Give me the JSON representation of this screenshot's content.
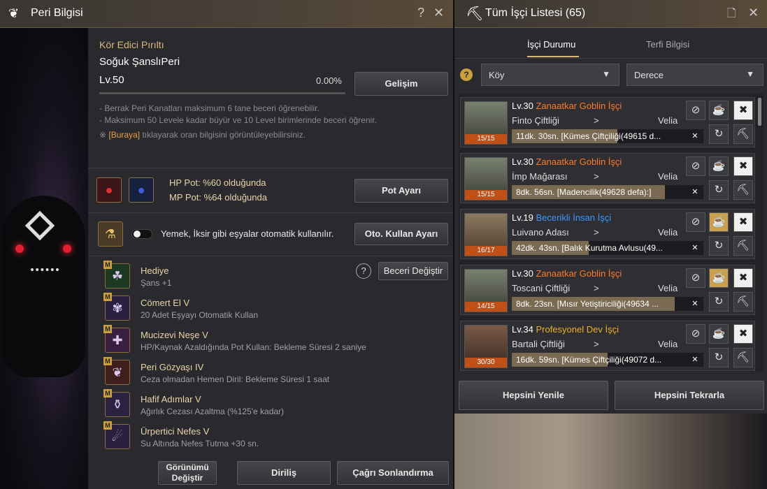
{
  "left": {
    "title": "Peri Bilgisi",
    "help": "?",
    "close": "✕",
    "fairy_title": "Kör Edici Pırıltı",
    "fairy_name": "Soğuk ŞanslıPeri",
    "level": "Lv.50",
    "percent": "0.00%",
    "exp_fraction": 0.0,
    "evolve_btn": "Gelişim",
    "note1": "- Berrak Peri Kanatları maksimum 6 tane beceri öğrenebilir.",
    "note2": "- Maksimum 50 Levele kadar büyür ve 10 Level birimlerinde beceri öğrenir.",
    "note3_mark": "※",
    "note3_link": "[Buraya]",
    "note3_rest": "tıklayarak oran bilgisini görüntüleyebilirsiniz.",
    "hp_text": "HP Pot: %60 olduğunda",
    "mp_text": "MP Pot: %64 olduğunda",
    "pot_btn": "Pot Ayarı",
    "auto_text": "Yemek, İksir gibi eşyalar otomatik kullanılır.",
    "auto_btn": "Oto. Kullan Ayarı",
    "change_skill_btn": "Beceri Değiştir",
    "skills": [
      {
        "tag": "M",
        "name": "Hediye",
        "desc": "Şans +1"
      },
      {
        "tag": "M",
        "name": "Cömert El V",
        "desc": "20 Adet Eşyayı Otomatik Kullan"
      },
      {
        "tag": "M",
        "name": "Mucizevi Neşe V",
        "desc": "HP/Kaynak Azaldığında Pot Kullan: Bekleme Süresi 2 saniye"
      },
      {
        "tag": "M",
        "name": "Peri Gözyaşı IV",
        "desc": "Ceza olmadan Hemen Diril: Bekleme Süresi 1 saat"
      },
      {
        "tag": "M",
        "name": "Hafif Adımlar V",
        "desc": "Ağırlık Cezası Azaltma (%125'e kadar)"
      },
      {
        "tag": "M",
        "name": "Ürpertici Nefes V",
        "desc": "Su Altında Nefes Tutma +30 sn."
      }
    ],
    "btn_view1": "Görünümü",
    "btn_view2": "Değiştir",
    "btn_revive": "Diriliş",
    "btn_recall": "Çağrı Sonlandırma"
  },
  "right": {
    "title": "Tüm İşçi Listesi (65)",
    "tab_status": "İşçi Durumu",
    "tab_promo": "Terfi Bilgisi",
    "help": "?",
    "filter_town": "Köy",
    "filter_grade": "Derece",
    "workers": [
      {
        "level": "Lv.30",
        "type": "Zanaatkar Goblin İşçi",
        "type_color": "#ff7a2a",
        "node": "Finto Çiftliği",
        "region": "Velia",
        "count": "15/15",
        "task": "11dk. 30sn. [Kümes Çiftçiliği(49615 d...",
        "progress": 0.55,
        "mug": false
      },
      {
        "level": "Lv.30",
        "type": "Zanaatkar Goblin İşçi",
        "type_color": "#ff7a2a",
        "node": "İmp Mağarası",
        "region": "Velia",
        "count": "15/15",
        "task": "8dk. 56sn. [Madencilik(49628 defa):]",
        "progress": 0.8,
        "mug": false
      },
      {
        "level": "Lv.19",
        "type": "Becerikli İnsan İşçi",
        "type_color": "#3a9aff",
        "node": "Luivano Adası",
        "region": "Velia",
        "count": "16/17",
        "task": "42dk. 43sn. [Balık Kurutma Avlusu(49...",
        "progress": 0.4,
        "mug": true
      },
      {
        "level": "Lv.30",
        "type": "Zanaatkar Goblin İşçi",
        "type_color": "#ff7a2a",
        "node": "Toscani Çiftliği",
        "region": "Velia",
        "count": "14/15",
        "task": "8dk. 23sn. [Mısır Yetiştiriciliği(49634 ...",
        "progress": 0.85,
        "mug": true
      },
      {
        "level": "Lv.34",
        "type": "Profesyonel Dev İşçi",
        "type_color": "#f0b020",
        "node": "Bartali Çiftliği",
        "region": "Velia",
        "count": "30/30",
        "task": "16dk. 59sn. [Kümes Çiftçiliği(49072 d...",
        "progress": 0.5,
        "mug": false
      }
    ],
    "arrow": ">",
    "remove": "✕",
    "refresh_all": "Hepsini Yenile",
    "repeat_all": "Hepsini Tekrarla"
  }
}
